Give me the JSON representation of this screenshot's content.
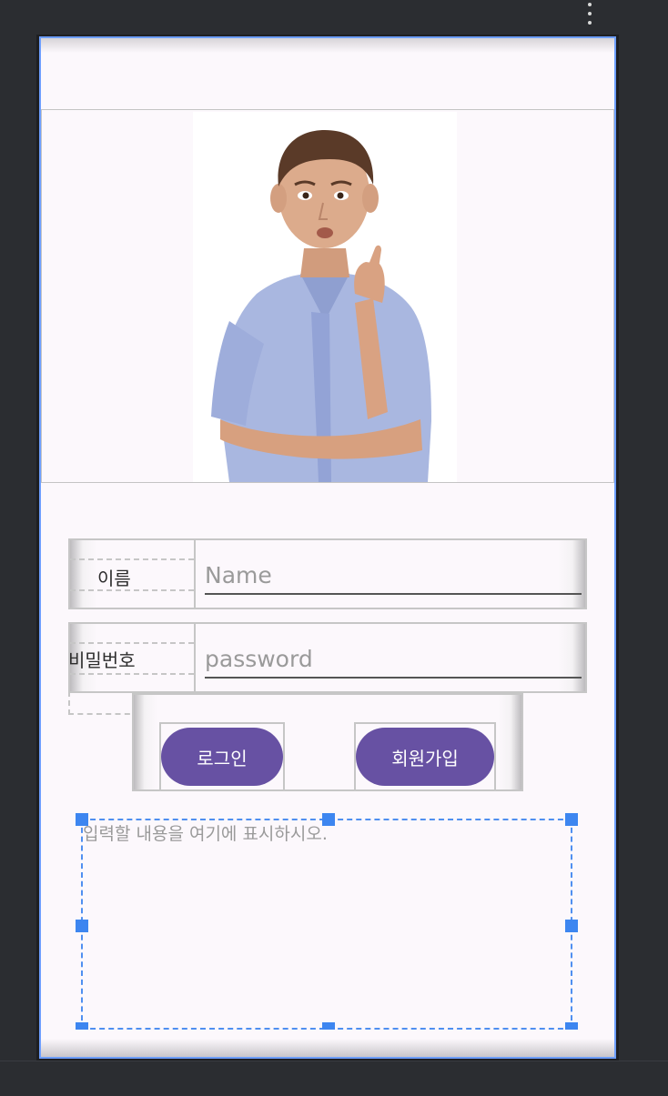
{
  "form": {
    "name_label": "이름",
    "name_placeholder": "Name",
    "name_value": "",
    "password_label": "비밀번호",
    "password_placeholder": "password",
    "password_value": ""
  },
  "buttons": {
    "login_label": "로그인",
    "signup_label": "회원가입"
  },
  "output": {
    "placeholder": "입력할 내용을 여기에 표시하시오.",
    "value": ""
  },
  "colors": {
    "button_bg": "#6751a3",
    "selection": "#3d86f0",
    "screen_bg": "#fcf8fc",
    "device_frame": "#1e1f22"
  },
  "icons": {
    "overflow": "more-vert-icon",
    "image": "boy-raising-finger-photo"
  }
}
